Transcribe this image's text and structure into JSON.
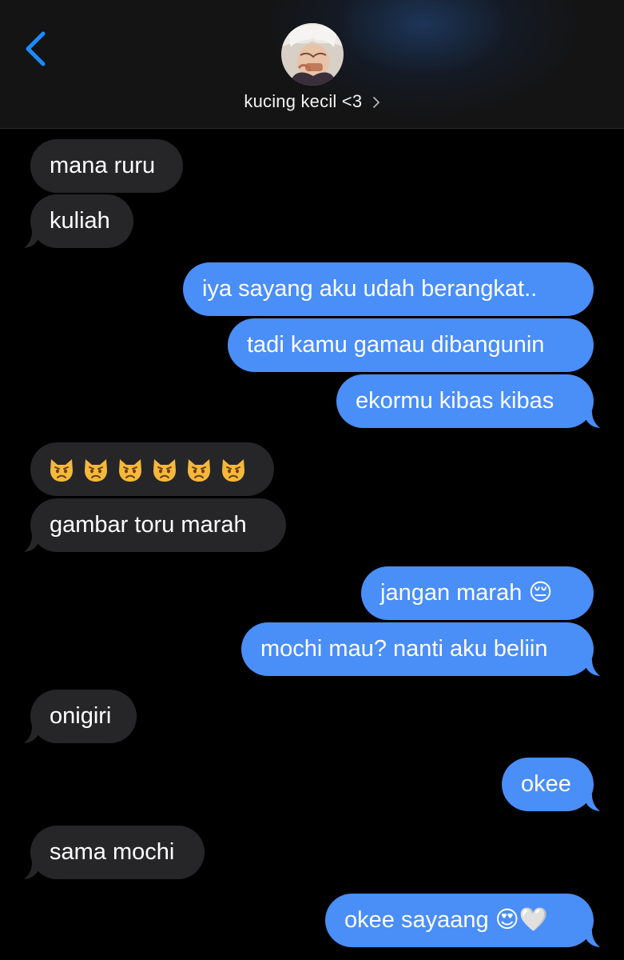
{
  "header": {
    "contact_name": "kucing kecil <3",
    "back_icon": "chevron-left-icon",
    "accent": "#1a8cff"
  },
  "messages": [
    {
      "side": "in",
      "text": "mana ruru"
    },
    {
      "side": "in",
      "text": "kuliah"
    },
    {
      "side": "out",
      "text": "iya sayang aku udah berangkat.."
    },
    {
      "side": "out",
      "text": "tadi kamu gamau dibangunin"
    },
    {
      "side": "out",
      "text": "ekormu kibas kibas"
    },
    {
      "side": "in",
      "text": "😾😾😾😾😾😾",
      "emoji": "pouting-cat-icon",
      "count": 6
    },
    {
      "side": "in",
      "text": "gambar toru marah"
    },
    {
      "side": "out",
      "text": "jangan marah 😔"
    },
    {
      "side": "out",
      "text": "mochi mau? nanti aku beliin"
    },
    {
      "side": "in",
      "text": "onigiri"
    },
    {
      "side": "out",
      "text": "okee"
    },
    {
      "side": "in",
      "text": "sama mochi"
    },
    {
      "side": "out",
      "text": "okee sayaang 😍🤍"
    }
  ],
  "colors": {
    "incoming_bubble": "#262628",
    "outgoing_bubble": "#4a8ef7",
    "background": "#000000"
  }
}
